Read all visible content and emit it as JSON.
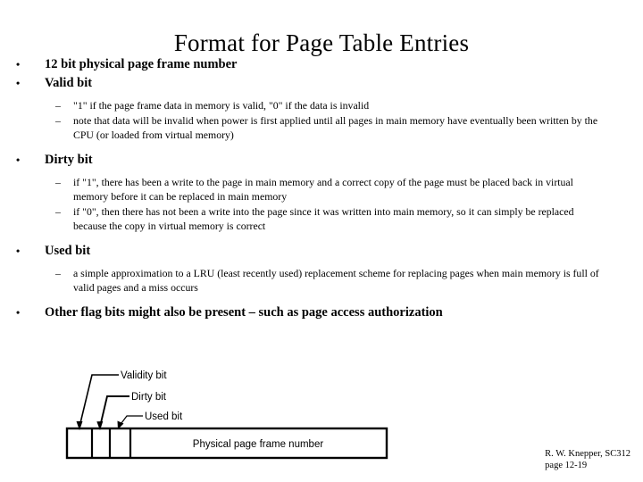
{
  "slide": {
    "title": "Format for Page Table Entries",
    "bullets": [
      {
        "level": 1,
        "marker": "•",
        "text": "12 bit physical page frame number"
      },
      {
        "level": 1,
        "marker": "•",
        "text": "Valid bit"
      },
      {
        "level": 2,
        "marker": "–",
        "text": "\"1\" if the page frame data in memory is valid, \"0\" if the data is invalid"
      },
      {
        "level": 2,
        "marker": "–",
        "text": "note that data will be invalid when power is first applied until all pages in main memory have eventually been written by the CPU (or loaded from virtual memory)"
      },
      {
        "level": 1,
        "marker": "•",
        "text": "Dirty bit"
      },
      {
        "level": 2,
        "marker": "–",
        "text": " if \"1\", there has been a write to the page in main memory and a correct copy of the page must be placed back in virtual memory before it can be replaced in main memory"
      },
      {
        "level": 2,
        "marker": "–",
        "text": "if \"0\", then there has not been a write into the page since it was written into main memory, so it can simply be replaced because the copy in virtual memory is correct"
      },
      {
        "level": 1,
        "marker": "•",
        "text": "Used bit"
      },
      {
        "level": 2,
        "marker": "–",
        "text": "a simple approximation to a LRU (least recently used) replacement scheme for replacing pages when main memory is full of valid pages and a miss occurs"
      },
      {
        "level": 1,
        "marker": "•",
        "text": "Other flag bits might also be present – such as page access authorization"
      }
    ]
  },
  "diagram": {
    "labels": {
      "validity_bit": "Validity bit",
      "dirty_bit": "Dirty bit",
      "used_bit": "Used bit",
      "frame_field": "Physical page frame number"
    },
    "line_color": "#000000"
  },
  "footer": {
    "line1": "R. W. Knepper, SC312",
    "line2": "page 12-19"
  }
}
